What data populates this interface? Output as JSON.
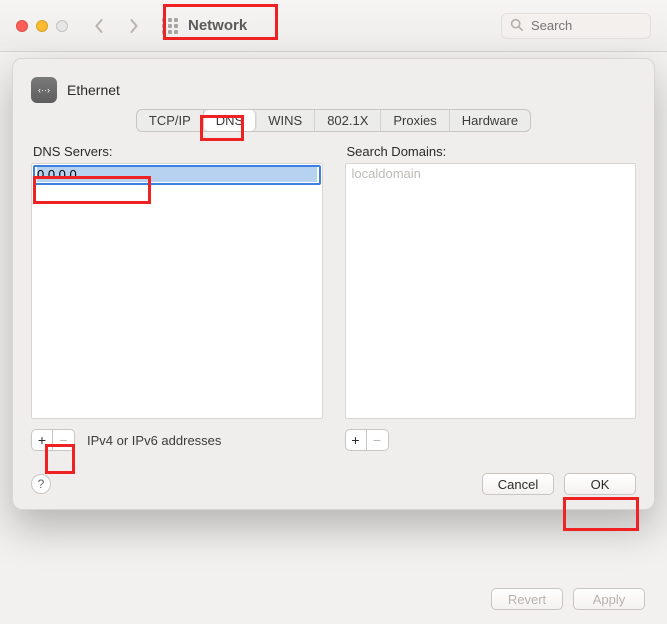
{
  "toolbar": {
    "window_title": "Network",
    "search_placeholder": "Search"
  },
  "sheet": {
    "interface_name": "Ethernet",
    "tabs": [
      "TCP/IP",
      "DNS",
      "WINS",
      "802.1X",
      "Proxies",
      "Hardware"
    ],
    "active_tab_index": 1,
    "dns": {
      "label": "DNS Servers:",
      "editing_value": "0.0.0.0",
      "hint": "IPv4 or IPv6 addresses"
    },
    "search_domains": {
      "label": "Search Domains:",
      "placeholder_item": "localdomain"
    },
    "buttons": {
      "plus": "+",
      "minus": "−",
      "help": "?",
      "cancel": "Cancel",
      "ok": "OK"
    }
  },
  "page_buttons": {
    "revert": "Revert",
    "apply": "Apply"
  }
}
